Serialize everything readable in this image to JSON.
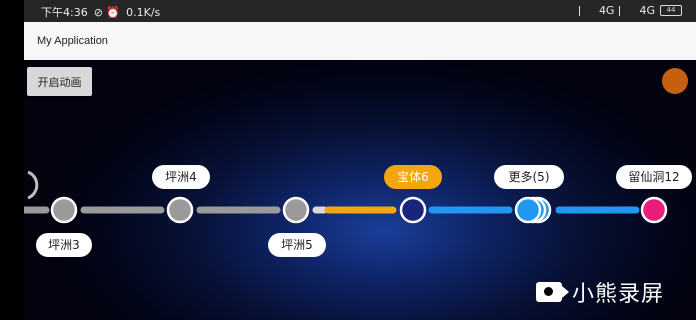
{
  "status_bar": {
    "time": "下午4:36",
    "speed": "0.1K/s",
    "network_1": "4G",
    "network_2": "4G",
    "battery": "44"
  },
  "app": {
    "title": "My Application"
  },
  "buttons": {
    "start_animation": "开启动画"
  },
  "progress": {
    "stations": [
      {
        "label": "坪洲3",
        "state": "passed"
      },
      {
        "label": "坪洲4",
        "state": "passed"
      },
      {
        "label": "坪洲5",
        "state": "passed"
      },
      {
        "label": "宝体6",
        "state": "current"
      },
      {
        "label": "更多(5)",
        "state": "more"
      },
      {
        "label": "留仙洞12",
        "state": "destination"
      }
    ]
  },
  "colors": {
    "passed": "#9a9a9a",
    "current": "#f3a60e",
    "upcoming": "#2196f3",
    "destination": "#e91e7a",
    "current_node": "#1a237e"
  },
  "watermark": {
    "text": "小熊录屏"
  }
}
